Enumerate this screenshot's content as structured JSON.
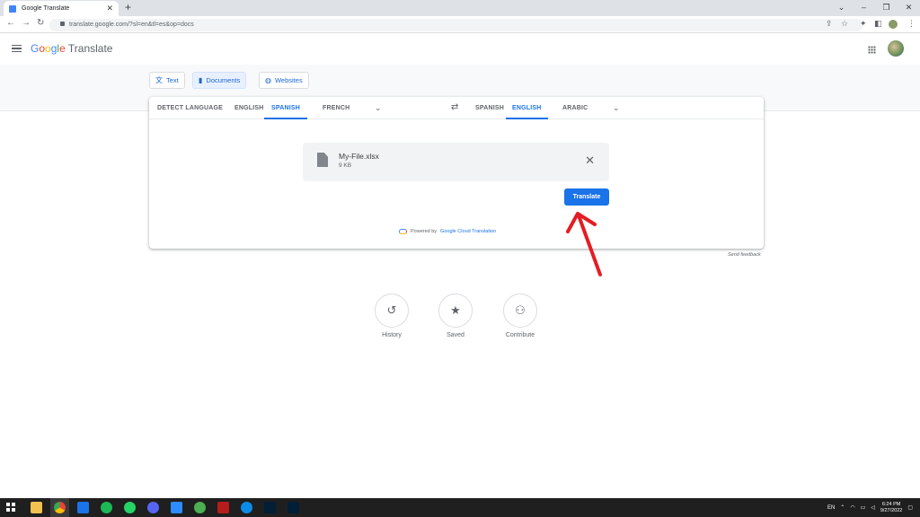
{
  "browser": {
    "tab_title": "Google Translate",
    "url": "translate.google.com/?sl=en&tl=es&op=docs"
  },
  "header": {
    "logo_google": [
      "G",
      "o",
      "o",
      "g",
      "l",
      "e"
    ],
    "logo_suffix": "Translate"
  },
  "modes": [
    {
      "label": "Text",
      "icon": "translate-icon",
      "active": false
    },
    {
      "label": "Documents",
      "icon": "document-icon",
      "active": true
    },
    {
      "label": "Websites",
      "icon": "globe-icon",
      "active": false
    }
  ],
  "source_langs": [
    "DETECT LANGUAGE",
    "ENGLISH",
    "SPANISH",
    "FRENCH"
  ],
  "source_active": "SPANISH",
  "target_langs": [
    "SPANISH",
    "ENGLISH",
    "ARABIC"
  ],
  "target_active": "ENGLISH",
  "file": {
    "name": "My-File.xlsx",
    "size": "9 KB"
  },
  "translate_button": "Translate",
  "powered": {
    "prefix": "Powered by",
    "link": "Google Cloud Translation"
  },
  "send_feedback": "Send feedback",
  "actions": [
    {
      "label": "History",
      "icon": "history-icon"
    },
    {
      "label": "Saved",
      "icon": "star-icon"
    },
    {
      "label": "Contribute",
      "icon": "people-icon"
    }
  ],
  "taskbar": {
    "lang": "EN",
    "time": "6:24 PM",
    "date": "9/27/2022"
  },
  "colors": {
    "accent": "#1a73e8",
    "annotation_arrow": "#e51c23"
  }
}
